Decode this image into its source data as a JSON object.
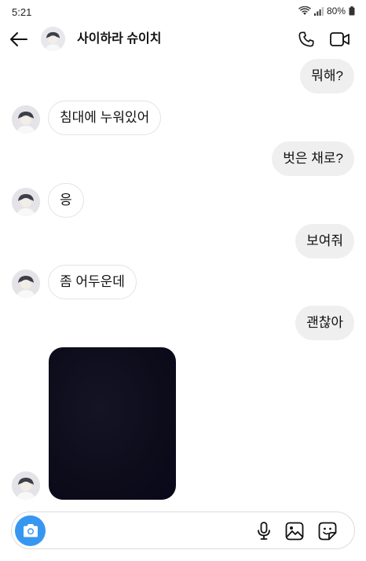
{
  "status_bar": {
    "time": "5:21",
    "battery": "80%"
  },
  "header": {
    "name": "사이하라 슈이치"
  },
  "messages": [
    {
      "side": "sent",
      "text": "뭐해?"
    },
    {
      "side": "received",
      "text": "침대에 누워있어"
    },
    {
      "side": "sent",
      "text": "벗은 채로?"
    },
    {
      "side": "received",
      "text": "응"
    },
    {
      "side": "sent",
      "text": "보여줘"
    },
    {
      "side": "received",
      "text": "좀 어두운데"
    },
    {
      "side": "sent",
      "text": "괜찮아"
    },
    {
      "side": "received",
      "type": "photo"
    }
  ],
  "composer": {
    "placeholder": ""
  },
  "colors": {
    "accent": "#3797f0",
    "sent_bubble": "#efefef",
    "received_border": "#e3e3e3",
    "photo": "#0c0c1a"
  }
}
